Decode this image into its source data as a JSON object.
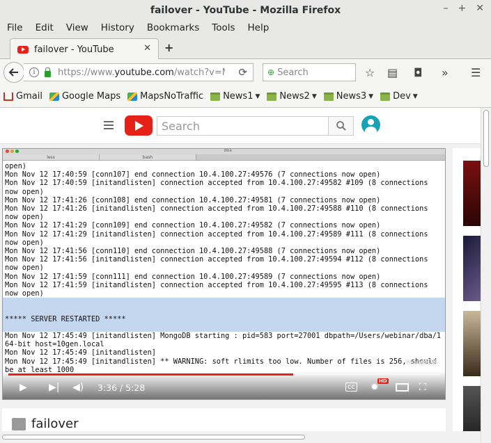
{
  "window": {
    "title": "failover - YouTube - Mozilla Firefox"
  },
  "menu": [
    "File",
    "Edit",
    "View",
    "History",
    "Bookmarks",
    "Tools",
    "Help"
  ],
  "tab": {
    "label": "failover - YouTube"
  },
  "nav": {
    "url_prefix": "https://www.",
    "url_host": "youtube.com",
    "url_rest": "/watch?v=MGol",
    "search_placeholder": "Search"
  },
  "bookmarks": [
    {
      "label": "Gmail",
      "icon": "gmail-icon"
    },
    {
      "label": "Google Maps",
      "icon": "maps-icon"
    },
    {
      "label": "MapsNoTraffic",
      "icon": "maps-icon"
    },
    {
      "label": "News1",
      "icon": "folder-icon"
    },
    {
      "label": "News2",
      "icon": "folder-icon"
    },
    {
      "label": "News3",
      "icon": "folder-icon"
    },
    {
      "label": "Dev",
      "icon": "folder-icon"
    }
  ],
  "youtube": {
    "search_placeholder": "Search"
  },
  "terminal": {
    "window_title": "dba",
    "tabs": [
      "less",
      "bash"
    ],
    "lines_before": "open)\nMon Nov 12 17:40:59 [conn107] end connection 10.4.100.27:49576 (7 connections now open)\nMon Nov 12 17:40:59 [initandlisten] connection accepted from 10.4.100.27:49582 #109 (8 connections now open)\nMon Nov 12 17:41:26 [conn108] end connection 10.4.100.27:49581 (7 connections now open)\nMon Nov 12 17:41:26 [initandlisten] connection accepted from 10.4.100.27:49588 #110 (8 connections now open)\nMon Nov 12 17:41:29 [conn109] end connection 10.4.100.27:49582 (7 connections now open)\nMon Nov 12 17:41:29 [initandlisten] connection accepted from 10.4.100.27:49589 #111 (8 connections now open)\nMon Nov 12 17:41:56 [conn110] end connection 10.4.100.27:49588 (7 connections now open)\nMon Nov 12 17:41:56 [initandlisten] connection accepted from 10.4.100.27:49594 #112 (8 connections now open)\nMon Nov 12 17:41:59 [conn111] end connection 10.4.100.27:49589 (7 connections now open)\nMon Nov 12 17:41:59 [initandlisten] connection accepted from 10.4.100.27:49595 #113 (8 connections now open)",
    "highlight": "\n\n***** SERVER RESTARTED *****\n\n",
    "lines_after": "Mon Nov 12 17:45:49 [initandlisten] MongoDB starting : pid=583 port=27001 dbpath=/Users/webinar/dba/1 64-bit host=10gen.local\nMon Nov 12 17:45:49 [initandlisten]\nMon Nov 12 17:45:49 [initandlisten] ** WARNING: soft rlimits too low. Number of files is 256, should be at least 1000",
    "watermark": "mongoDB"
  },
  "player": {
    "time": "3:36 / 5:28",
    "progress": 0.66,
    "hd_badge": "HD"
  },
  "video": {
    "title": "failover"
  },
  "colors": {
    "accent": "#e62117",
    "highlight": "#c5d7ef"
  }
}
